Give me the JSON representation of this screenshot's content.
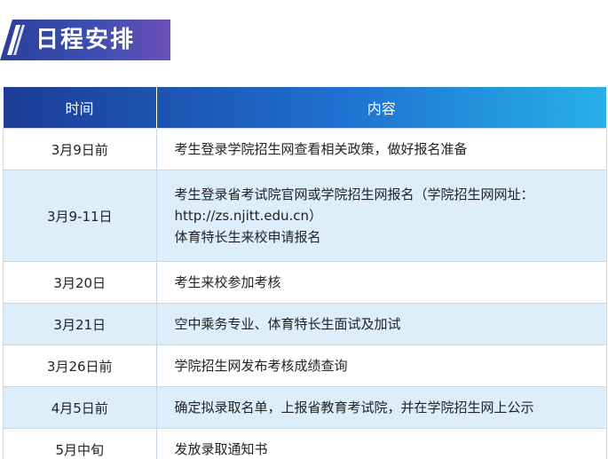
{
  "title": "日程安排",
  "table": {
    "headers": {
      "time": "时间",
      "content": "内容"
    },
    "rows": [
      {
        "time": "3月9日前",
        "lines": [
          "考生登录学院招生网查看相关政策，做好报名准备"
        ]
      },
      {
        "time": "3月9-11日",
        "lines": [
          "考生登录省考试院官网或学院招生网报名（学院招生网网址：",
          "http://zs.njitt.edu.cn）",
          "体育特长生来校申请报名"
        ]
      },
      {
        "time": "3月20日",
        "lines": [
          "考生来校参加考核"
        ]
      },
      {
        "time": "3月21日",
        "lines": [
          "空中乘务专业、体育特长生面试及加试"
        ]
      },
      {
        "time": "3月26日前",
        "lines": [
          "学院招生网发布考核成绩查询"
        ]
      },
      {
        "time": "4月5日前",
        "lines": [
          "确定拟录取名单，上报省教育考试院，并在学院招生网上公示"
        ]
      },
      {
        "time": "5月中旬",
        "lines": [
          "发放录取通知书"
        ]
      }
    ]
  },
  "colors": {
    "header_start": "#1c3c96",
    "header_end": "#27b0e8",
    "alt_row": "#dceefa",
    "banner": "#2a3f9c"
  }
}
